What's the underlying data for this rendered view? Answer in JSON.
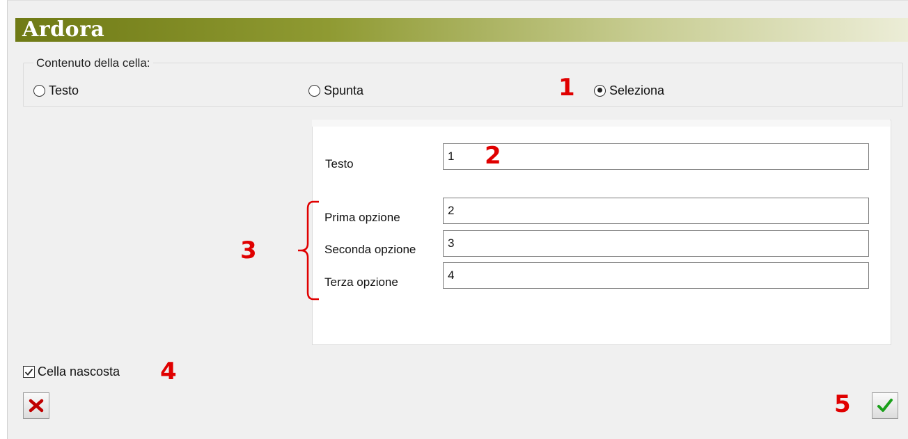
{
  "app": {
    "title": "Ardora"
  },
  "content_group": {
    "legend": "Contenuto della cella:",
    "options": [
      {
        "label": "Testo",
        "checked": false
      },
      {
        "label": "Spunta",
        "checked": false
      },
      {
        "label": "Seleziona",
        "checked": true
      }
    ]
  },
  "panel": {
    "text_label": "Testo",
    "text_value": "1",
    "option1_label": "Prima opzione",
    "option1_value": "2",
    "option2_label": "Seconda opzione",
    "option2_value": "3",
    "option3_label": "Terza opzione",
    "option3_value": "4"
  },
  "hidden_cell": {
    "label": "Cella nascosta",
    "checked": true
  },
  "buttons": {
    "cancel_icon": "red-x-icon",
    "confirm_icon": "green-check-icon"
  },
  "annotations": [
    "1",
    "2",
    "3",
    "4",
    "5"
  ],
  "colors": {
    "annotation": "#e00000",
    "title_bar": "#6f7a15",
    "confirm": "#1aa01a",
    "cancel": "#c00000"
  }
}
